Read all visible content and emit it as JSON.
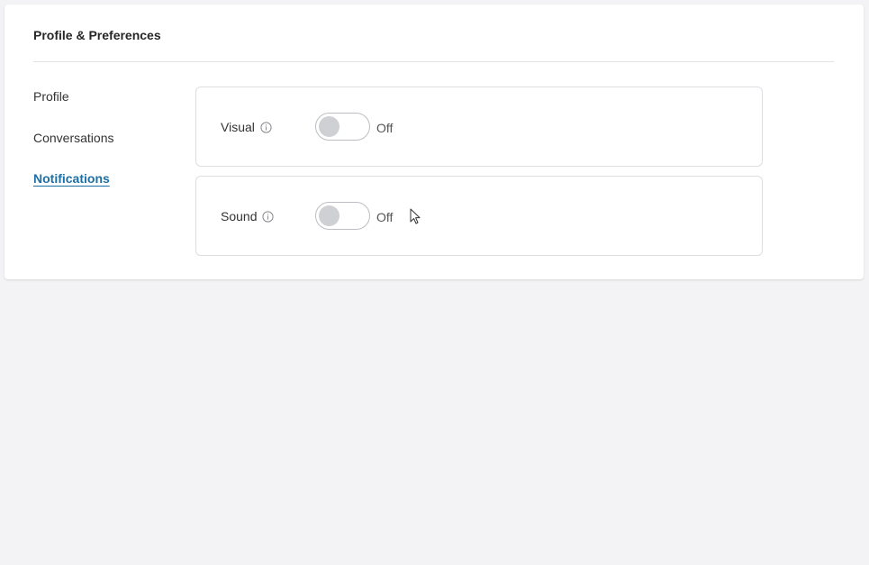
{
  "page": {
    "title": "Profile & Preferences"
  },
  "nav": {
    "items": [
      {
        "label": "Profile",
        "active": false
      },
      {
        "label": "Conversations",
        "active": false
      },
      {
        "label": "Notifications",
        "active": true
      }
    ]
  },
  "settings": [
    {
      "label": "Visual",
      "icon": "info-icon",
      "state": "Off",
      "enabled": false
    },
    {
      "label": "Sound",
      "icon": "info-icon",
      "state": "Off",
      "enabled": false
    }
  ],
  "colors": {
    "background": "#f3f3f5",
    "accent": "#1d6fa5",
    "toggle_off_knob": "#cfd0d3"
  }
}
